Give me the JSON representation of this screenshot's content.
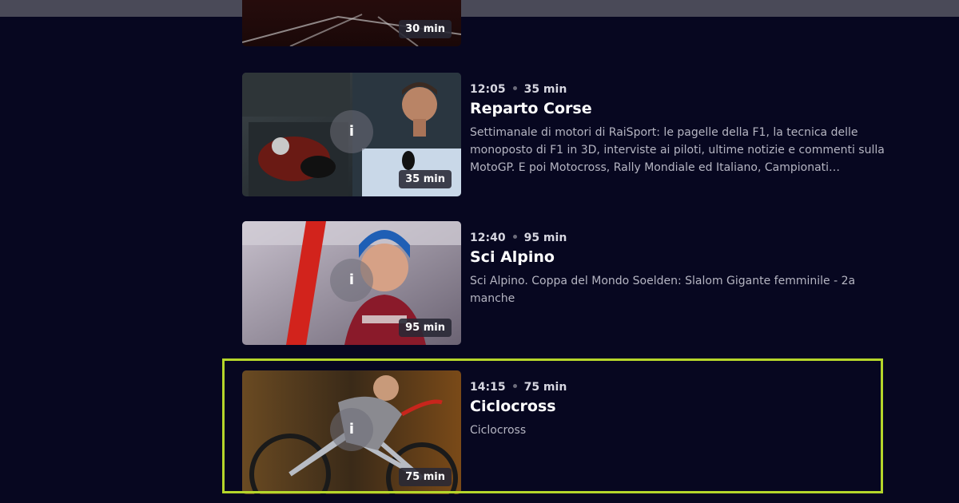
{
  "colors": {
    "background": "#070720",
    "top_bar": "#4a4a58",
    "focus_border": "#b5d62a",
    "badge_bg": "#28283a"
  },
  "programs": [
    {
      "duration_badge": "30 min",
      "info_icon": "i",
      "thumbnail": "track-athletics"
    },
    {
      "time": "12:05",
      "duration": "35 min",
      "title": "Reparto Corse",
      "description": "Settimanale di motori di RaiSport: le pagelle della F1, la tecnica delle monoposto di F1 in 3D, interviste ai piloti, ultime notizie e commenti sulla MotoGP. E poi Motocross, Rally Mondiale ed Italiano, Campionati…",
      "duration_badge": "35 min",
      "info_icon": "i",
      "thumbnail": "presenter-motorbike"
    },
    {
      "time": "12:40",
      "duration": "95 min",
      "title": "Sci Alpino",
      "description": "Sci Alpino. Coppa del Mondo Soelden: Slalom Gigante femminile - 2a manche",
      "duration_badge": "95 min",
      "info_icon": "i",
      "thumbnail": "skier-portrait"
    },
    {
      "time": "14:15",
      "duration": "75 min",
      "title": "Ciclocross",
      "description": "Ciclocross",
      "duration_badge": "75 min",
      "info_icon": "i",
      "thumbnail": "cyclocross-rider",
      "focused": true
    }
  ]
}
